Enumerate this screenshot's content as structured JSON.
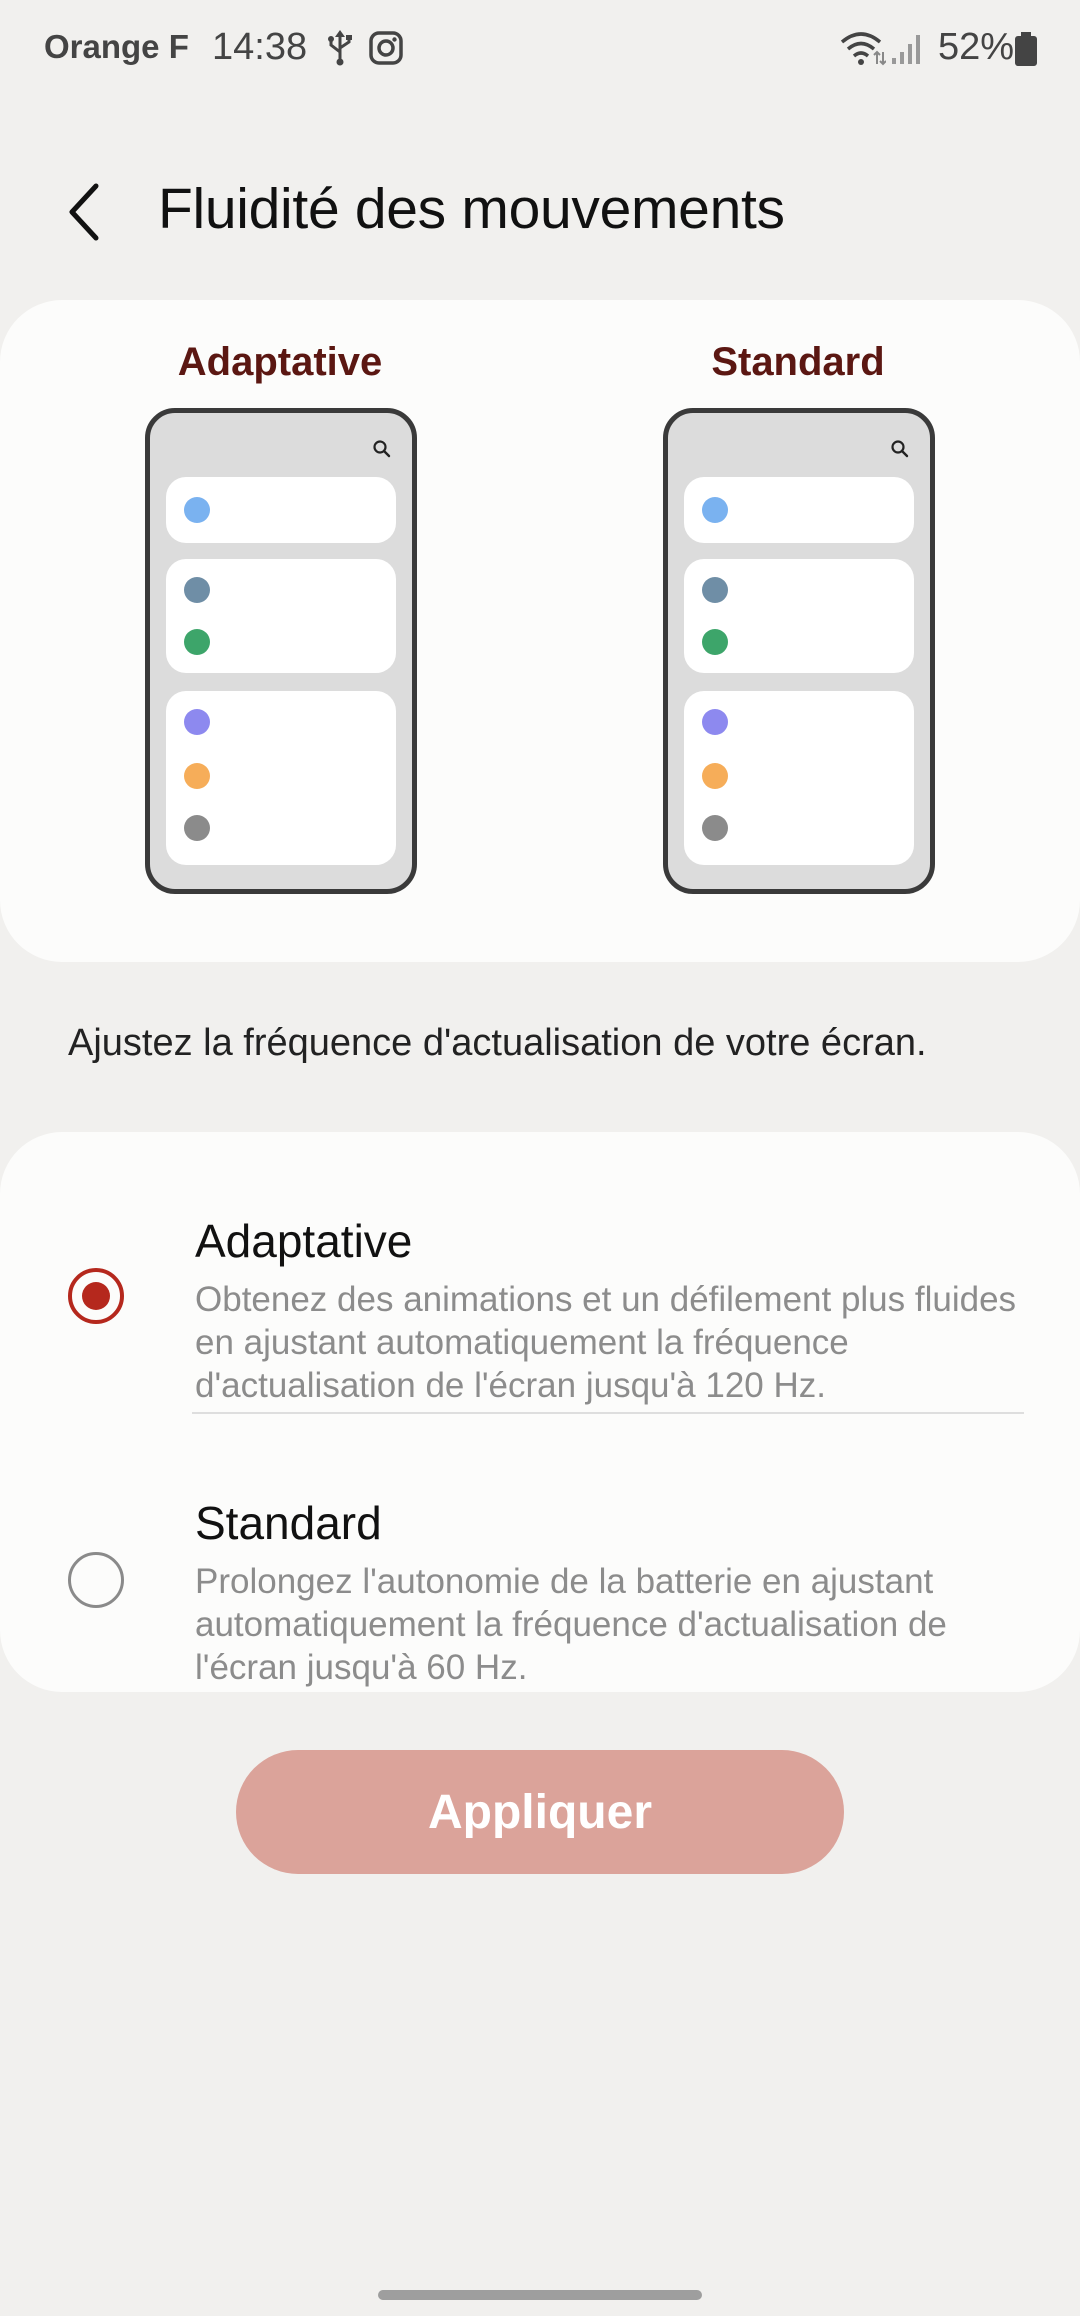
{
  "status_bar": {
    "carrier": "Orange F",
    "time": "14:38",
    "battery_percent": "52%",
    "icons": [
      "usb-icon",
      "instagram-icon",
      "wifi-icon",
      "signal-icon",
      "battery-icon"
    ]
  },
  "header": {
    "title": "Fluidité des mouvements",
    "back_icon": "chevron-left-icon"
  },
  "preview": {
    "left_label": "Adaptative",
    "right_label": "Standard",
    "dot_colors": [
      "#7ab2f0",
      "#6f8ea6",
      "#3da56a",
      "#8d89ef",
      "#f6ad59",
      "#8b8b8b"
    ]
  },
  "description": "Ajustez la fréquence d'actualisation de votre écran.",
  "options": [
    {
      "title": "Adaptative",
      "description": "Obtenez des animations et un défilement plus fluides en ajustant automatiquement la fréquence d'actualisation de l'écran jusqu'à 120 Hz.",
      "selected": true
    },
    {
      "title": "Standard",
      "description": "Prolongez l'autonomie de la batterie en ajustant automatiquement la fréquence d'actualisation de l'écran jusqu'à 60 Hz.",
      "selected": false
    }
  ],
  "apply_button": {
    "label": "Appliquer",
    "enabled": false
  },
  "colors": {
    "accent": "#b5281d",
    "button_disabled": "#dba39a",
    "preview_label": "#5b1712",
    "background": "#f1f0ee",
    "card": "#fcfcfb"
  }
}
